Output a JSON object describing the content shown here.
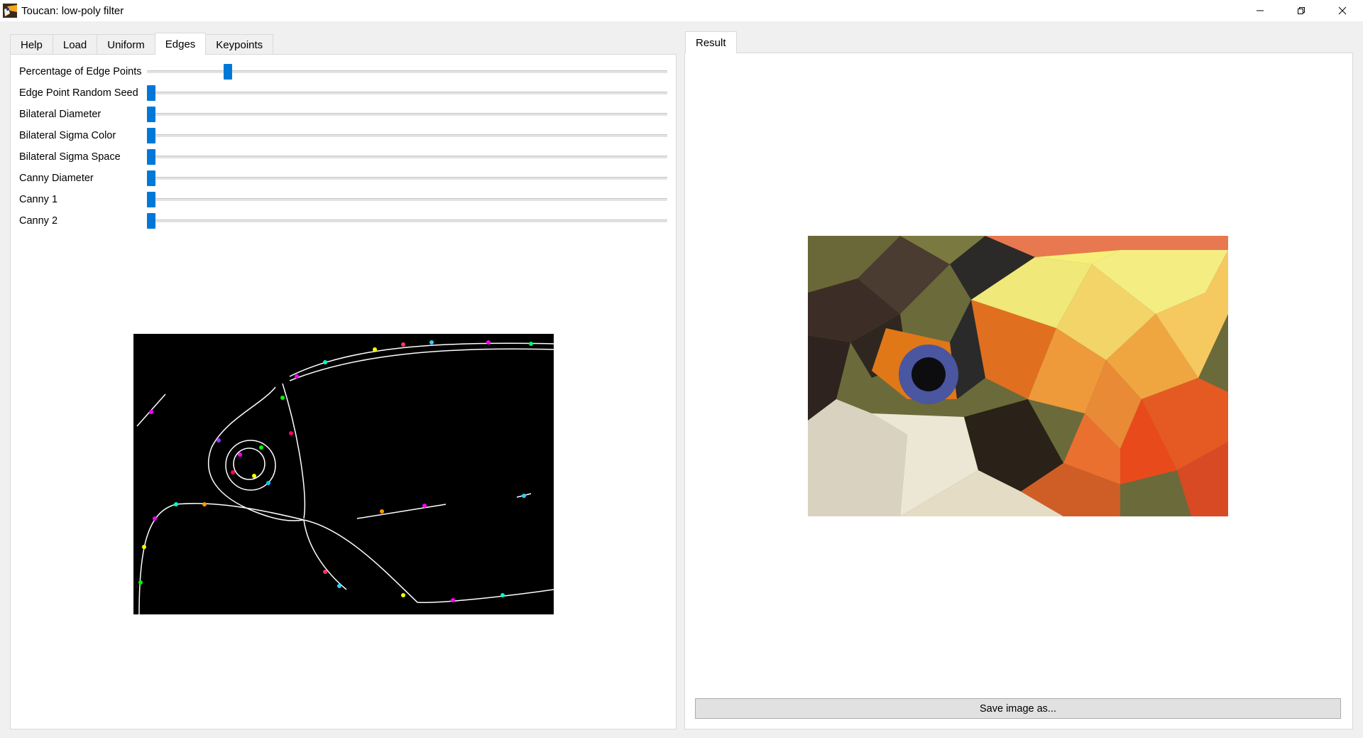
{
  "window": {
    "title": "Toucan: low-poly filter",
    "icons": [
      "toucan-app-icon",
      "minimize-icon",
      "maximize-icon",
      "close-icon"
    ]
  },
  "left_tabs": [
    {
      "label": "Help",
      "active": false
    },
    {
      "label": "Load",
      "active": false
    },
    {
      "label": "Uniform",
      "active": false
    },
    {
      "label": "Edges",
      "active": true
    },
    {
      "label": "Keypoints",
      "active": false
    }
  ],
  "sliders": [
    {
      "label": "Percentage of Edge Points",
      "value": 0.15
    },
    {
      "label": "Edge Point Random Seed",
      "value": 0.0
    },
    {
      "label": "Bilateral Diameter",
      "value": 0.0
    },
    {
      "label": "Bilateral Sigma Color",
      "value": 0.0
    },
    {
      "label": "Bilateral Sigma Space",
      "value": 0.0
    },
    {
      "label": "Canny Diameter",
      "value": 0.0
    },
    {
      "label": "Canny 1",
      "value": 0.0
    },
    {
      "label": "Canny 2",
      "value": 0.0
    }
  ],
  "right_tabs": [
    {
      "label": "Result",
      "active": true
    }
  ],
  "save_button_label": "Save image as...",
  "colors": {
    "accent": "#0078d7",
    "panel_bg": "#ffffff",
    "window_bg": "#f0f0f0"
  }
}
